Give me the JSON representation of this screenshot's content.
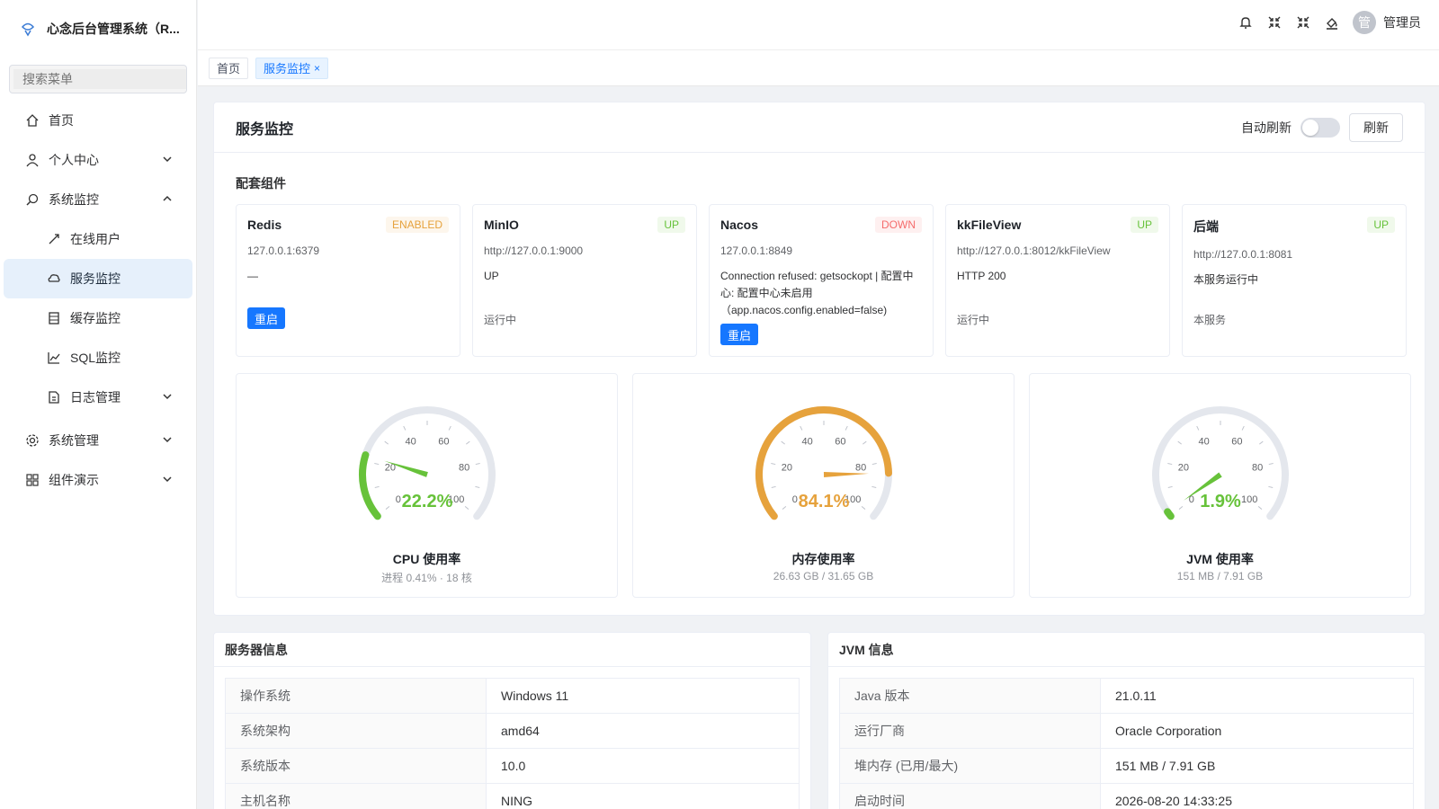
{
  "app": {
    "title": "心念后台管理系统（R..."
  },
  "search": {
    "placeholder": "搜索菜单"
  },
  "sidebar": {
    "items": [
      {
        "label": "首页",
        "icon": "home-icon"
      },
      {
        "label": "个人中心",
        "icon": "user-icon"
      },
      {
        "label": "系统监控",
        "icon": "monitor-icon"
      },
      {
        "label": "在线用户",
        "icon": "link-icon"
      },
      {
        "label": "服务监控",
        "icon": "cloud-icon"
      },
      {
        "label": "缓存监控",
        "icon": "cache-icon"
      },
      {
        "label": "SQL监控",
        "icon": "chart-icon"
      },
      {
        "label": "日志管理",
        "icon": "log-icon"
      },
      {
        "label": "系统管理",
        "icon": "gear-icon"
      },
      {
        "label": "组件演示",
        "icon": "grid-icon"
      }
    ]
  },
  "header": {
    "avatar_text": "管",
    "user": "管理员"
  },
  "tags": {
    "home": "首页",
    "current": "服务监控",
    "close": "×"
  },
  "monitor": {
    "title": "服务监控",
    "auto_refresh_label": "自动刷新",
    "auto_refresh_on": false,
    "refresh_label": "刷新",
    "components_title": "配套组件",
    "components": [
      {
        "name": "Redis",
        "status": "ENABLED",
        "url": "127.0.0.1:6379",
        "info": "—",
        "sub": "",
        "action": "重启"
      },
      {
        "name": "MinIO",
        "status": "UP",
        "url": "http://127.0.0.1:9000",
        "info": "UP",
        "sub": "运行中",
        "action": ""
      },
      {
        "name": "Nacos",
        "status": "DOWN",
        "url": "127.0.0.1:8849",
        "info": "Connection refused: getsockopt | 配置中心: 配置中心未启用（app.nacos.config.enabled=false)",
        "sub": "",
        "action": "重启"
      },
      {
        "name": "kkFileView",
        "status": "UP",
        "url": "http://127.0.0.1:8012/kkFileView",
        "info": "HTTP 200",
        "sub": "运行中",
        "action": ""
      },
      {
        "name": "后端",
        "status": "UP",
        "url": "http://127.0.0.1:8081",
        "info": "本服务运行中",
        "sub": "本服务",
        "action": ""
      }
    ],
    "gauges": [
      {
        "name": "CPU 使用率",
        "value": 22.2,
        "label": "22.2%",
        "sub": "进程 0.41% · 18 核",
        "color": "#67c23a"
      },
      {
        "name": "内存使用率",
        "value": 84.1,
        "label": "84.1%",
        "sub": "26.63 GB / 31.65 GB",
        "color": "#e6a23c"
      },
      {
        "name": "JVM 使用率",
        "value": 1.9,
        "label": "1.9%",
        "sub": "151 MB / 7.91 GB",
        "color": "#67c23a"
      }
    ],
    "gauge_ticks": [
      "0",
      "20",
      "40",
      "60",
      "80",
      "100"
    ]
  },
  "server": {
    "title": "服务器信息",
    "rows": [
      {
        "k": "操作系统",
        "v": "Windows 11"
      },
      {
        "k": "系统架构",
        "v": "amd64"
      },
      {
        "k": "系统版本",
        "v": "10.0"
      },
      {
        "k": "主机名称",
        "v": "NING"
      }
    ]
  },
  "jvm": {
    "title": "JVM 信息",
    "rows": [
      {
        "k": "Java 版本",
        "v": "21.0.11"
      },
      {
        "k": "运行厂商",
        "v": "Oracle Corporation"
      },
      {
        "k": "堆内存 (已用/最大)",
        "v": "151 MB / 7.91 GB"
      },
      {
        "k": "启动时间",
        "v": "2026-08-20 14:33:25"
      }
    ]
  }
}
